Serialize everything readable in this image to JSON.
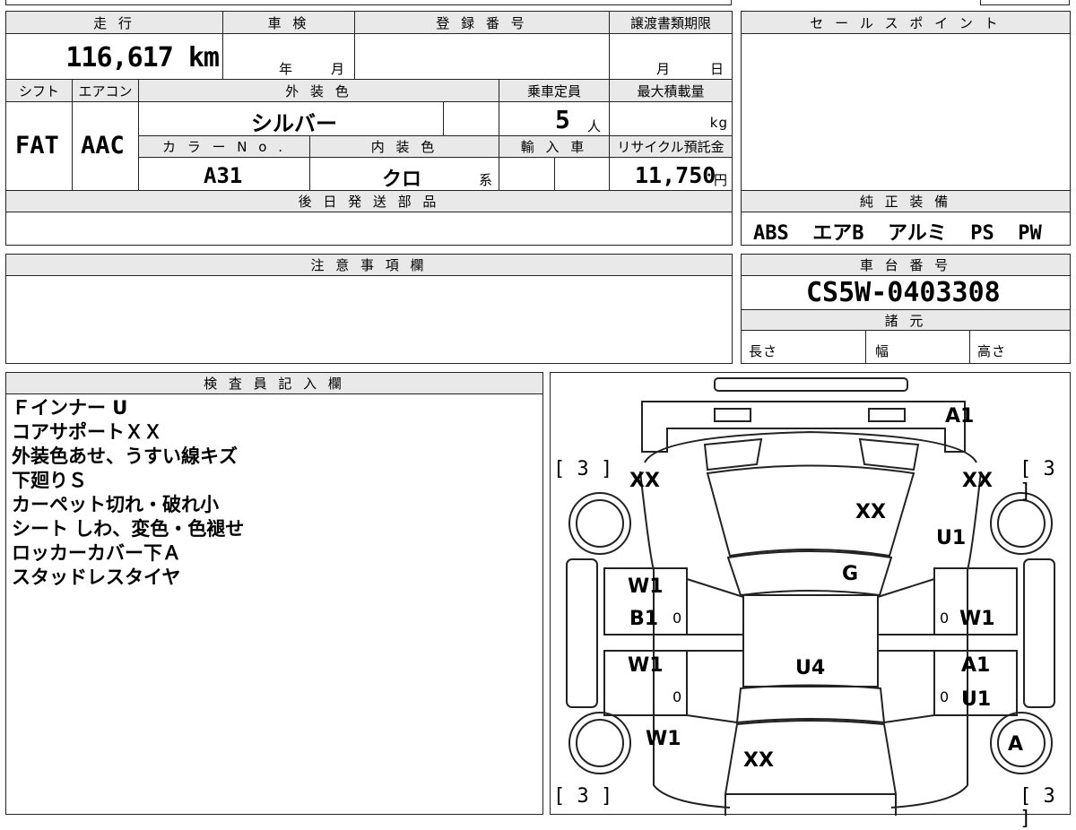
{
  "top_table": {
    "mileage_label": "走 行",
    "mileage_value": "116,617 km",
    "inspection_label": "車 検",
    "inspection_year_unit": "年",
    "inspection_month_unit": "月",
    "registration_label": "登 録 番 号",
    "transfer_deadline_label": "譲渡書類期限",
    "transfer_month_unit": "月",
    "transfer_day_unit": "日",
    "shift_label": "シフト",
    "aircon_label": "エアコン",
    "exterior_color_label": "外 装 色",
    "capacity_label": "乗車定員",
    "max_load_label": "最大積載量",
    "shift_value": "FAT",
    "aircon_value": "AAC",
    "exterior_color_value": "シルバー",
    "capacity_value": "5",
    "capacity_unit": "人",
    "max_load_unit": "kg",
    "color_no_label": "カ ラ ー N o .",
    "interior_color_label": "内 装 色",
    "import_label": "輸 入 車",
    "recycle_label": "リサイクル預託金",
    "color_no_value": "A31",
    "interior_color_value": "クロ",
    "interior_color_suffix": "系",
    "recycle_value": "11,750",
    "recycle_unit": "円",
    "shipping_parts_label": "後 日 発 送 部 品"
  },
  "sales_point": {
    "label": "セ ー ル ス ポ イ ン ト"
  },
  "genuine_equipment": {
    "label": "純 正 装 備",
    "value": "ABS  エアB  アルミ  PS  PW"
  },
  "notes": {
    "label": "注 意 事 項 欄"
  },
  "chassis": {
    "label": "車 台 番 号",
    "value": "CS5W-0403308",
    "specs_label": "諸 元",
    "length_label": "長さ",
    "width_label": "幅",
    "height_label": "高さ"
  },
  "inspector": {
    "label": "検 査 員 記 入 欄",
    "lines": [
      "Ｆインナー U",
      "コアサポートＸＸ",
      "外装色あせ、うすい線キズ",
      "下廻りＳ",
      "カーペット切れ・破れ小",
      "シート しわ、変色・色褪せ",
      "ロッカーカバー下Ａ",
      "スタッドレスタイヤ"
    ]
  },
  "diagram": {
    "marks": {
      "a1_top": "A1",
      "xx_left_front": "XX",
      "xx_right_front": "XX",
      "xx_hood": "XX",
      "u1_right_front": "U1",
      "g_windshield": "G",
      "w1_left_front_door": "W1",
      "b1_left_front_door": "B1",
      "w1_right_front_door": "W1",
      "u4_roof": "U4",
      "w1_left_rear_door": "W1",
      "a1_right_rear_door": "A1",
      "u1_right_rear_door": "U1",
      "w1_left_rear": "W1",
      "a_right_rear_wheel": "A",
      "xx_rear": "XX"
    },
    "tire_brackets": {
      "front_left": "[ 3 ]",
      "front_right": "[ 3 ]",
      "rear_left": "[ 3 ]",
      "rear_right": "[ 3 ]"
    },
    "zero_marks": [
      "0",
      "0",
      "0",
      "0"
    ]
  }
}
